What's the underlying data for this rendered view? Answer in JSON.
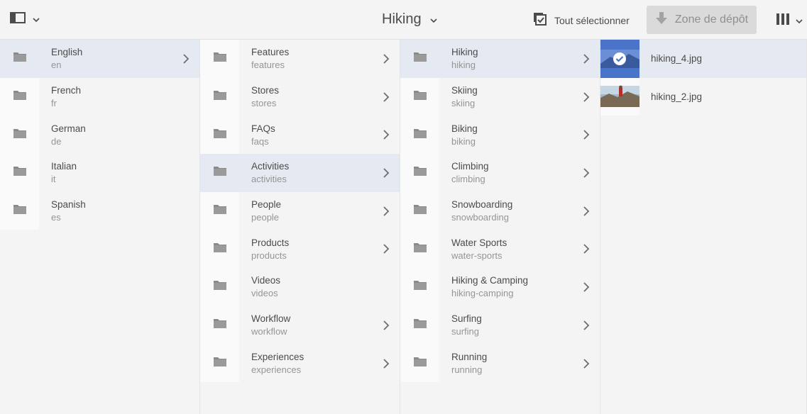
{
  "toolbar": {
    "rail_toggle_icon": "sidebar-panel-icon",
    "title": "Hiking",
    "select_all_label": "Tout sélectionner",
    "dropzone_label": "Zone de dépôt",
    "view_switch_icon": "column-view-icon"
  },
  "columns": [
    {
      "items": [
        {
          "title": "English",
          "name": "en",
          "active": true,
          "has_children": true
        },
        {
          "title": "French",
          "name": "fr",
          "active": false,
          "has_children": false
        },
        {
          "title": "German",
          "name": "de",
          "active": false,
          "has_children": false
        },
        {
          "title": "Italian",
          "name": "it",
          "active": false,
          "has_children": false
        },
        {
          "title": "Spanish",
          "name": "es",
          "active": false,
          "has_children": false
        }
      ]
    },
    {
      "items": [
        {
          "title": "Features",
          "name": "features",
          "active": false,
          "has_children": true
        },
        {
          "title": "Stores",
          "name": "stores",
          "active": false,
          "has_children": true
        },
        {
          "title": "FAQs",
          "name": "faqs",
          "active": false,
          "has_children": true
        },
        {
          "title": "Activities",
          "name": "activities",
          "active": true,
          "has_children": true
        },
        {
          "title": "People",
          "name": "people",
          "active": false,
          "has_children": true
        },
        {
          "title": "Products",
          "name": "products",
          "active": false,
          "has_children": true
        },
        {
          "title": "Videos",
          "name": "videos",
          "active": false,
          "has_children": false
        },
        {
          "title": "Workflow",
          "name": "workflow",
          "active": false,
          "has_children": true
        },
        {
          "title": "Experiences",
          "name": "experiences",
          "active": false,
          "has_children": true
        }
      ]
    },
    {
      "items": [
        {
          "title": "Hiking",
          "name": "hiking",
          "active": true,
          "has_children": true
        },
        {
          "title": "Skiing",
          "name": "skiing",
          "active": false,
          "has_children": true
        },
        {
          "title": "Biking",
          "name": "biking",
          "active": false,
          "has_children": true
        },
        {
          "title": "Climbing",
          "name": "climbing",
          "active": false,
          "has_children": true
        },
        {
          "title": "Snowboarding",
          "name": "snowboarding",
          "active": false,
          "has_children": true
        },
        {
          "title": "Water Sports",
          "name": "water-sports",
          "active": false,
          "has_children": true
        },
        {
          "title": "Hiking & Camping",
          "name": "hiking-camping",
          "active": false,
          "has_children": true
        },
        {
          "title": "Surfing",
          "name": "surfing",
          "active": false,
          "has_children": true
        },
        {
          "title": "Running",
          "name": "running",
          "active": false,
          "has_children": true
        }
      ]
    }
  ],
  "files": [
    {
      "name": "hiking_4.jpg",
      "selected": true
    },
    {
      "name": "hiking_2.jpg",
      "selected": false
    }
  ],
  "colors": {
    "active_row": "#e5e9f1",
    "folder_icon": "#8a8a8a",
    "selection_overlay": "#4a74c9"
  }
}
